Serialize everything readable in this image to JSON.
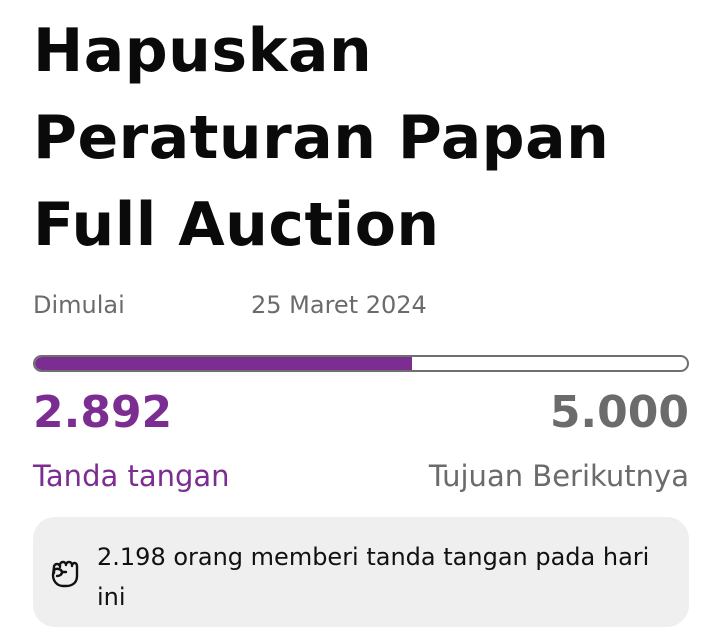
{
  "petition": {
    "title": "Hapuskan Peraturan Papan Full Auction",
    "started_label": "Dimulai",
    "started_date": "25 Maret 2024"
  },
  "progress": {
    "signatures": 2892,
    "signature_count_text": "2.892",
    "signature_label": "Tanda tangan",
    "goal": 5000,
    "goal_text": "5.000",
    "goal_label": "Tujuan Berikutnya",
    "fill_fraction": 0.578,
    "color_accent": "#7b2d91",
    "color_muted": "#6b6b6b"
  },
  "today": {
    "icon": "raised-fist-icon",
    "text": "2.198 orang memberi tanda tangan pada hari ini"
  }
}
